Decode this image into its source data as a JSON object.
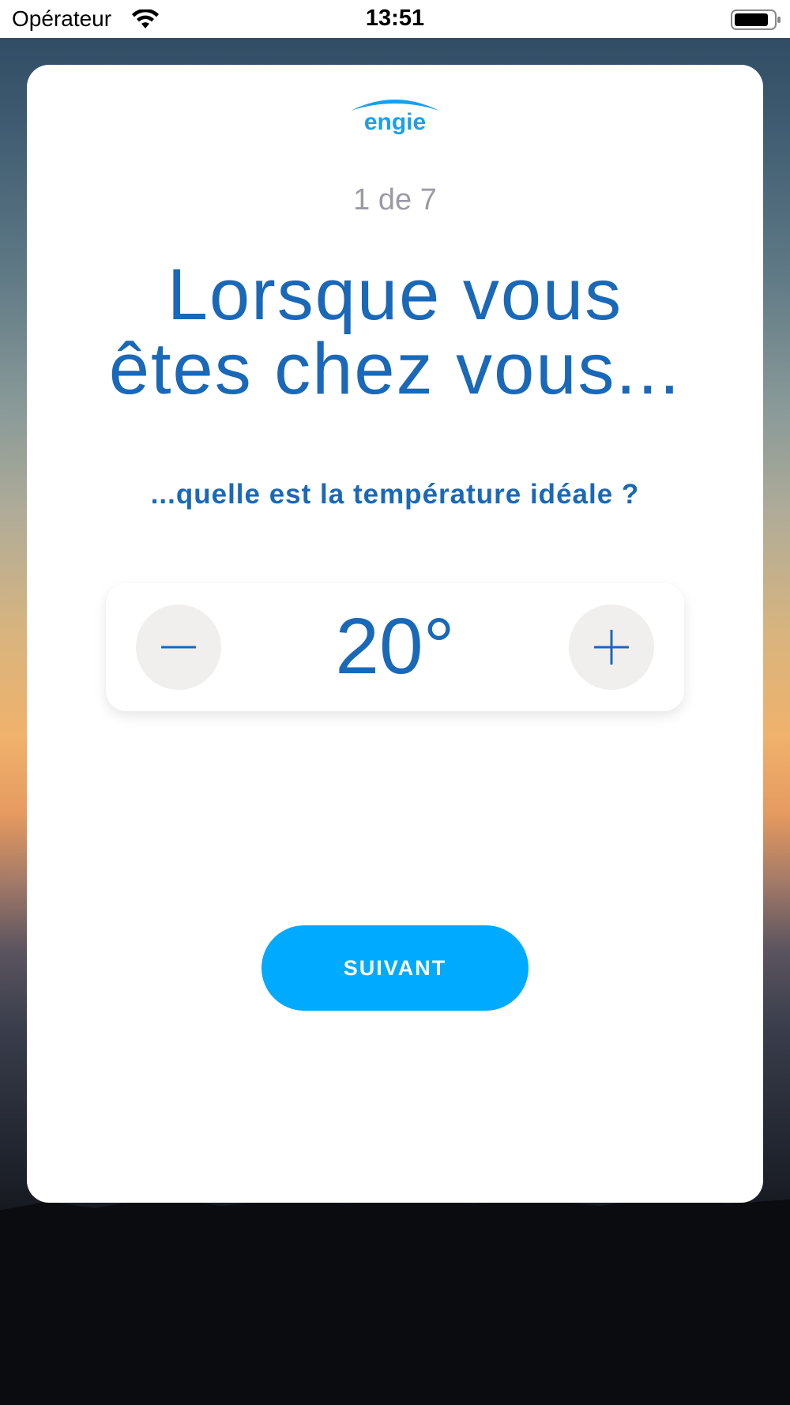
{
  "status_bar": {
    "carrier": "Opérateur",
    "time": "13:51"
  },
  "card": {
    "logo_text": "engie",
    "step": "1 de 7",
    "title_line1": "Lorsque vous",
    "title_line2": "êtes chez vous...",
    "subtitle": "...quelle est la température idéale ?",
    "temperature": "20°",
    "next_label": "SUIVANT"
  },
  "colors": {
    "brand_blue": "#1a68b8",
    "button_blue": "#00aaff",
    "logo_blue": "#1aa0e8"
  },
  "icons": [
    "wifi-icon",
    "battery-icon",
    "minus-icon",
    "plus-icon",
    "engie-logo"
  ]
}
